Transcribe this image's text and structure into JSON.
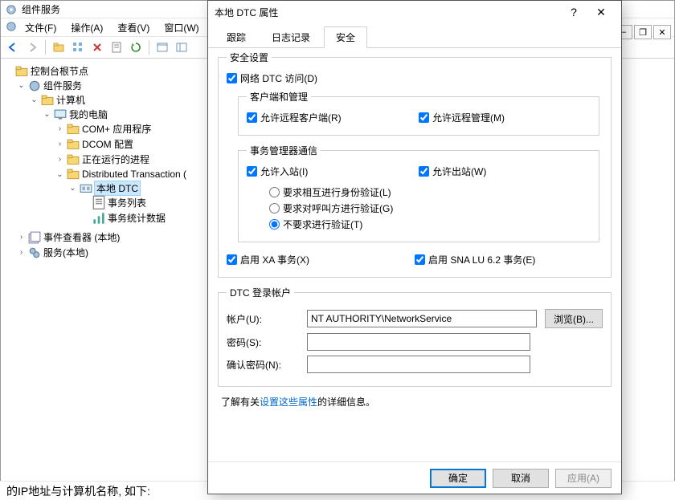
{
  "mmc": {
    "title": "组件服务",
    "menu": {
      "file": "文件(F)",
      "action": "操作(A)",
      "view": "查看(V)",
      "window": "窗口(W)"
    },
    "tree": {
      "root": "控制台根节点",
      "compsvc": "组件服务",
      "computers": "计算机",
      "my_computer": "我的电脑",
      "complus": "COM+ 应用程序",
      "dcom": "DCOM 配置",
      "running": "正在运行的进程",
      "dtc": "Distributed Transaction (",
      "local_dtc": "本地 DTC",
      "tx_list": "事务列表",
      "tx_stats": "事务统计数据",
      "event_viewer": "事件查看器 (本地)",
      "services": "服务(本地)"
    }
  },
  "below": "的IP地址与计算机名称, 如下:",
  "dialog": {
    "title": "本地 DTC 属性",
    "tabs": {
      "trace": "跟踪",
      "log": "日志记录",
      "security": "安全"
    },
    "security_settings": "安全设置",
    "network_dtc": "网络 DTC 访问(D)",
    "client_admin": "客户端和管理",
    "allow_remote_client": "允许远程客户端(R)",
    "allow_remote_admin": "允许远程管理(M)",
    "txmgr_comm": "事务管理器通信",
    "allow_inbound": "允许入站(I)",
    "allow_outbound": "允许出站(W)",
    "require_mutual": "要求相互进行身份验证(L)",
    "require_caller": "要求对呼叫方进行验证(G)",
    "no_auth": "不要求进行验证(T)",
    "enable_xa": "启用 XA 事务(X)",
    "enable_sna": "启用 SNA LU 6.2 事务(E)",
    "logon_group": "DTC 登录帐户",
    "account_label": "帐户(U):",
    "account_value": "NT AUTHORITY\\NetworkService",
    "browse": "浏览(B)...",
    "password_label": "密码(S):",
    "confirm_label": "确认密码(N):",
    "info_prefix": "了解有关",
    "info_link": "设置这些属性",
    "info_suffix": "的详细信息。",
    "ok": "确定",
    "cancel": "取消",
    "apply": "应用(A)"
  }
}
